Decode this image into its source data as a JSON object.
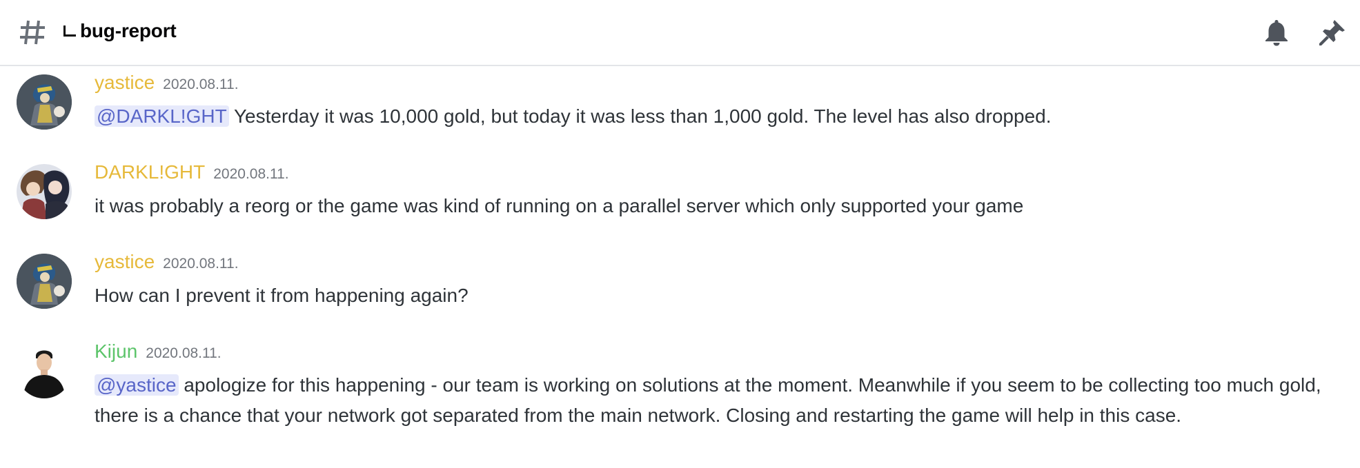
{
  "channel": {
    "name": "bug-report",
    "is_thread": true
  },
  "header_icons": [
    "bell-icon",
    "pin-icon"
  ],
  "colors": {
    "username_yellow": "#e6b93a",
    "username_green": "#5cc46a",
    "mention_bg": "#e6e9fb",
    "mention_text": "#5865c8"
  },
  "messages": [
    {
      "author": "yastice",
      "timestamp": "2020.08.11.",
      "mention": "@DARKL!GHT",
      "text": " Yesterday it was 10,000 gold, but today it was less than 1,000 gold. The level has also dropped."
    },
    {
      "author": "DARKL!GHT",
      "timestamp": "2020.08.11.",
      "mention": "",
      "text": "it was probably a reorg or the game was kind of running on a parallel server which only supported your game"
    },
    {
      "author": "yastice",
      "timestamp": "2020.08.11.",
      "mention": "",
      "text": "How can I prevent it from happening again?"
    },
    {
      "author": "Kijun",
      "timestamp": "2020.08.11.",
      "mention": "@yastice",
      "text": " apologize for this happening - our team is working on solutions at the moment. Meanwhile if you seem to be collecting too much gold, there is a chance that your network got separated from the main network. Closing and restarting the game will help in this case."
    }
  ]
}
